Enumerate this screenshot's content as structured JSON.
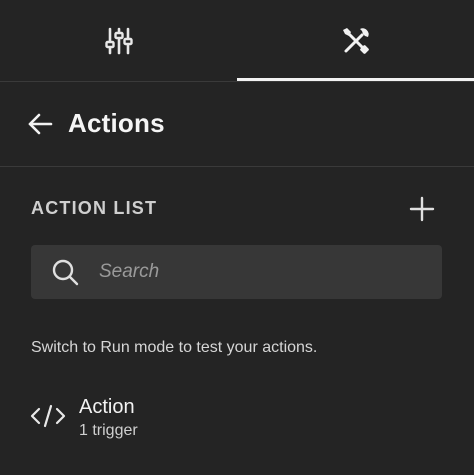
{
  "tabs": [
    {
      "icon": "sliders-icon",
      "active": false
    },
    {
      "icon": "tools-icon",
      "active": true
    }
  ],
  "header": {
    "title": "Actions",
    "back_icon": "arrow-left-icon"
  },
  "section": {
    "label": "ACTION LIST",
    "add_icon": "plus-icon"
  },
  "search": {
    "placeholder": "Search",
    "value": "",
    "icon": "search-icon"
  },
  "hint": "Switch to Run mode to test your actions.",
  "actions": [
    {
      "name": "Action",
      "subtitle": "1 trigger",
      "icon": "code-icon"
    }
  ],
  "colors": {
    "background": "#242424",
    "search_bg": "#373737",
    "text": "#f2f2f2",
    "divider": "#3a3a3a"
  }
}
